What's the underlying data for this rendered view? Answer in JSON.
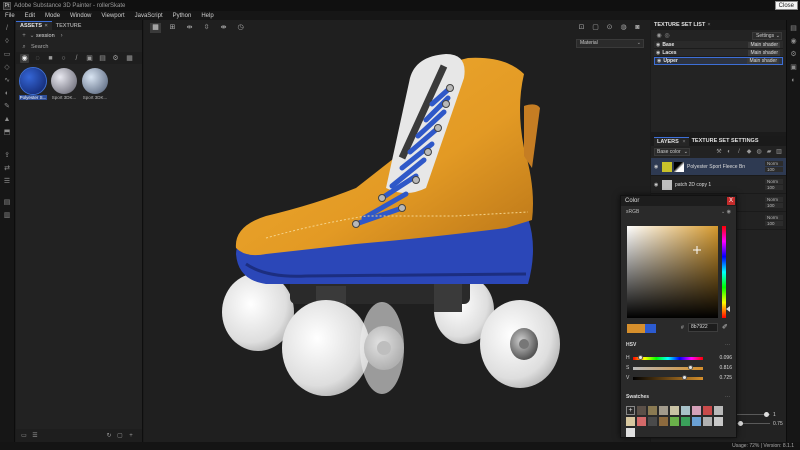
{
  "titlebar": {
    "app_icon": "Pt",
    "title": "Adobe Substance 3D Painter - rollerSkate",
    "close_tooltip": "Close"
  },
  "menu": [
    "File",
    "Edit",
    "Mode",
    "Window",
    "Viewport",
    "JavaScript",
    "Python",
    "Help"
  ],
  "left_tools": [
    "brush-icon",
    "eraser-icon",
    "projection-icon",
    "geometry-mask-icon",
    "smudge-icon",
    "clone-icon",
    "material-picker-icon",
    "polygon-fill-icon",
    "bake-icon",
    "export-icon",
    "share-icon"
  ],
  "assets": {
    "tabs": [
      {
        "label": "ASSETS",
        "close": "×"
      },
      {
        "label": "TEXTURE"
      }
    ],
    "session_label": "session",
    "search_placeholder": "Search",
    "items": [
      {
        "label": "Polyester S...",
        "color_inner": "#3566d6",
        "color_outer": "#0d1f63",
        "selected": true
      },
      {
        "label": "Sport 3DK...",
        "color_inner": "#e8e8f0",
        "color_outer": "#5a5a66",
        "selected": false
      },
      {
        "label": "Sport 3DK...",
        "color_inner": "#d8e4f2",
        "color_outer": "#4a5870",
        "selected": false
      }
    ]
  },
  "viewport": {
    "material_select": "Material",
    "skate": {
      "shell": "#e39a24",
      "sole": "#2b47b8",
      "laces": "#2f58c8",
      "wheel": "#e9e9e9"
    }
  },
  "texture_set_list": {
    "title": "TEXTURE SET LIST",
    "close": "×",
    "settings_label": "Settings",
    "items": [
      {
        "name": "Base",
        "shader": "Main shader",
        "selected": false
      },
      {
        "name": "Laces",
        "shader": "Main shader",
        "selected": false
      },
      {
        "name": "Upper",
        "shader": "Main shader",
        "selected": true
      }
    ]
  },
  "layers": {
    "tabs": [
      "LAYERS",
      "TEXTURE SET SETTINGS"
    ],
    "close": "×",
    "channel": "Base color",
    "rows": [
      {
        "name": "Polyester Sport Fleece Brus...",
        "blend": "Norm",
        "opacity": "100",
        "thumb": "#c9c22a",
        "selected": true
      },
      {
        "name": "patch 2D copy 1",
        "blend": "Norm",
        "opacity": "100",
        "thumb": "#bdbdbd",
        "selected": false
      },
      {
        "name": "",
        "blend": "Norm",
        "opacity": "100",
        "thumb": "#888",
        "selected": false
      },
      {
        "name": "",
        "blend": "Norm",
        "opacity": "100",
        "thumb": "#888",
        "selected": false
      }
    ],
    "slider_values": [
      "1",
      "0.75"
    ]
  },
  "color_dialog": {
    "title": "Color",
    "close": "X",
    "color_space": "sRGB",
    "hex_label": "#",
    "hex": "8b7922",
    "current_color": "#d68f2c",
    "previous_color": "#2c5bd0",
    "hsv_label": "HSV",
    "hsv": [
      {
        "key": "H",
        "value": "0.096",
        "fraction": 0.096
      },
      {
        "key": "S",
        "value": "0.816",
        "fraction": 0.816
      },
      {
        "key": "V",
        "value": "0.725",
        "fraction": 0.725
      }
    ],
    "swatches_label": "Swatches",
    "swatches": [
      "#5b5048",
      "#8a7a52",
      "#a29b8c",
      "#c9c2a4",
      "#a8c2c9",
      "#d4a0b8",
      "#c94a4a",
      "#b9b9b9",
      "#d8c8a0",
      "#d46a6a",
      "#4a4a4a",
      "#8c6a3e",
      "#6ab04a",
      "#3aa05a",
      "#6aa0d4",
      "#b0b0b0",
      "#c8c8c8",
      "#e0e0e0"
    ]
  },
  "status": {
    "text": "Usage:  72%  |  Version: 8.1.1"
  }
}
